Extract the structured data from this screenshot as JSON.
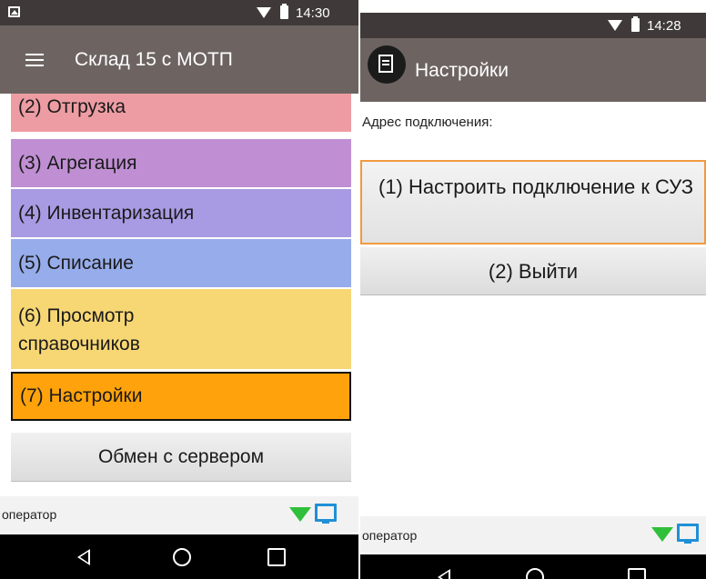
{
  "left": {
    "status": {
      "time": "14:30"
    },
    "appbar": {
      "title": "Склад 15 с МОТП"
    },
    "menu_items": [
      {
        "label": "(2) Отгрузка",
        "color": "#ed9ca3"
      },
      {
        "label": "(3) Агрегация",
        "color": "#c08fd3"
      },
      {
        "label": "(4) Инвентаризация",
        "color": "#a99be3"
      },
      {
        "label": "(5) Списание",
        "color": "#97acea"
      },
      {
        "label": "(6) Просмотр справочников",
        "color": "#f7d774"
      },
      {
        "label": "(7) Настройки",
        "color": "#ffa20c",
        "selected": true
      }
    ],
    "exchange_button": "Обмен с сервером",
    "footer": {
      "operator": "оператор"
    }
  },
  "right": {
    "status": {
      "time": "14:28"
    },
    "appbar": {
      "title": "Настройки"
    },
    "connection": {
      "label": "Адрес подключения:",
      "value": ""
    },
    "buttons": {
      "configure": "(1) Настроить подключение к СУЗ",
      "exit": "(2) Выйти"
    },
    "footer": {
      "operator": "оператор"
    }
  },
  "colors": {
    "statusbar": "#3f3a39",
    "appbar": "#6d6462",
    "focus_border": "#f19a3e",
    "wifi": "#2fbf3a",
    "monitor": "#1f8fd6"
  }
}
